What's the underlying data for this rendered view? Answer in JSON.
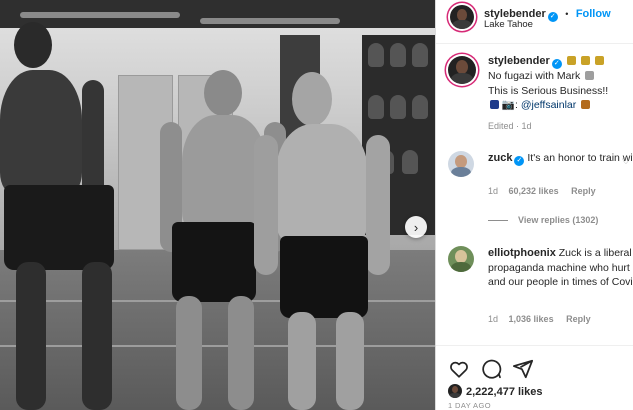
{
  "post": {
    "author": "stylebender",
    "follow_label": "Follow",
    "separator": "•",
    "location": "Lake Tahoe",
    "caption_lines": [
      "No fugazi with Mark",
      "This is Serious Business!!"
    ],
    "caption_credit_prefix": "📷: ",
    "caption_mention": "@jeffsainlar",
    "caption_status": "Edited · 1d"
  },
  "comments": [
    {
      "username": "zuck",
      "text": "It's an honor to train with you guys!",
      "time": "1d",
      "likes": "60,232 likes",
      "reply_label": "Reply",
      "view_replies": "View replies (1302)"
    },
    {
      "username": "elliotphoenix",
      "text": "Zuck is a liberal propaganda machine who hurt our country and our people in times of Covid scam.",
      "time": "1d",
      "likes": "1,036 likes",
      "reply_label": "Reply"
    }
  ],
  "actions": {
    "like_icon": "heart-icon",
    "comment_icon": "comment-icon",
    "share_icon": "paper-plane-icon",
    "likes_count": "2,222,477 likes",
    "date": "1 DAY AGO"
  },
  "colors": {
    "accent": "#0095f6",
    "ring": "#d62976",
    "mention": "#00376b",
    "muted": "#8e8e8e"
  }
}
